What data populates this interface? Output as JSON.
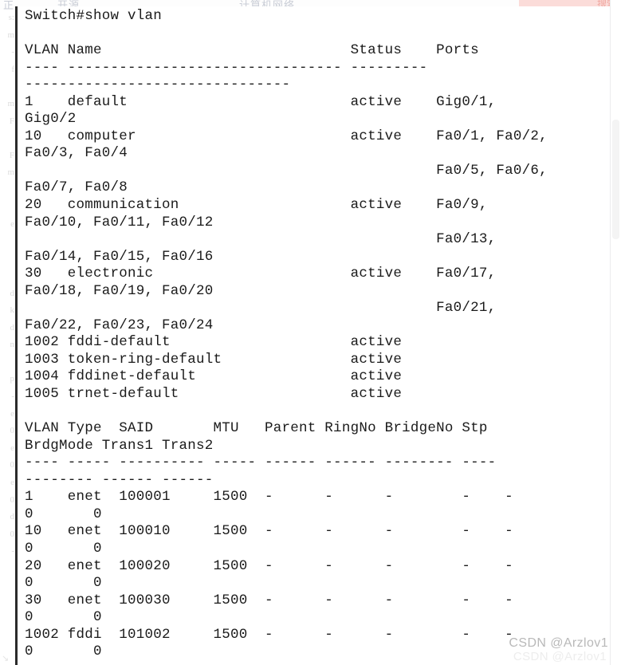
{
  "window": {
    "background_color": "#ffffff",
    "text_color": "#1a1a1a",
    "border_color": "#2b2b2b"
  },
  "top_strip": {
    "ghost_left": "正",
    "ghost_middle": "开源",
    "ghost_right": "计算机网络",
    "badge_label": "搜索",
    "badge_color": "#fbdcd9"
  },
  "ghost_margin": {
    "lines": "s:\nm\n-\nf\n\nm\nF\n\nF\nm\n\n\ne\n\n\n\nd\nk\nd\nn\n\np\n-\ne\n0\ne\n0\ne\n0\nd\n0\n-\n\n"
  },
  "terminal": {
    "prompt_line": "Switch#show vlan",
    "content": "Switch#show vlan\n\nVLAN Name                             Status    Ports\n---- -------------------------------- ---------\n-------------------------------\n1    default                          active    Gig0/1,\nGig0/2\n10   computer                         active    Fa0/1, Fa0/2,\nFa0/3, Fa0/4\n                                                Fa0/5, Fa0/6,\nFa0/7, Fa0/8\n20   communication                    active    Fa0/9,\nFa0/10, Fa0/11, Fa0/12\n                                                Fa0/13,\nFa0/14, Fa0/15, Fa0/16\n30   electronic                       active    Fa0/17,\nFa0/18, Fa0/19, Fa0/20\n                                                Fa0/21,\nFa0/22, Fa0/23, Fa0/24\n1002 fddi-default                     active\n1003 token-ring-default               active\n1004 fddinet-default                  active\n1005 trnet-default                    active\n\nVLAN Type  SAID       MTU   Parent RingNo BridgeNo Stp\nBrdgMode Trans1 Trans2\n---- ----- ---------- ----- ------ ------ -------- ----\n-------- ------ ------\n1    enet  100001     1500  -      -      -        -    -\n0       0\n10   enet  100010     1500  -      -      -        -    -\n0       0\n20   enet  100020     1500  -      -      -        -    -\n0       0\n30   enet  100030     1500  -      -      -        -    -\n0       0\n1002 fddi  101002     1500  -      -      -        -    -\n0       0"
  },
  "vlan_table": {
    "headers": [
      "VLAN",
      "Name",
      "Status",
      "Ports"
    ],
    "rows": [
      {
        "vlan": "1",
        "name": "default",
        "status": "active",
        "ports": [
          "Gig0/1",
          "Gig0/2"
        ]
      },
      {
        "vlan": "10",
        "name": "computer",
        "status": "active",
        "ports": [
          "Fa0/1",
          "Fa0/2",
          "Fa0/3",
          "Fa0/4",
          "Fa0/5",
          "Fa0/6",
          "Fa0/7",
          "Fa0/8"
        ]
      },
      {
        "vlan": "20",
        "name": "communication",
        "status": "active",
        "ports": [
          "Fa0/9",
          "Fa0/10",
          "Fa0/11",
          "Fa0/12",
          "Fa0/13",
          "Fa0/14",
          "Fa0/15",
          "Fa0/16"
        ]
      },
      {
        "vlan": "30",
        "name": "electronic",
        "status": "active",
        "ports": [
          "Fa0/17",
          "Fa0/18",
          "Fa0/19",
          "Fa0/20",
          "Fa0/21",
          "Fa0/22",
          "Fa0/23",
          "Fa0/24"
        ]
      },
      {
        "vlan": "1002",
        "name": "fddi-default",
        "status": "active",
        "ports": []
      },
      {
        "vlan": "1003",
        "name": "token-ring-default",
        "status": "active",
        "ports": []
      },
      {
        "vlan": "1004",
        "name": "fddinet-default",
        "status": "active",
        "ports": []
      },
      {
        "vlan": "1005",
        "name": "trnet-default",
        "status": "active",
        "ports": []
      }
    ]
  },
  "vlan_detail_table": {
    "headers": [
      "VLAN",
      "Type",
      "SAID",
      "MTU",
      "Parent",
      "RingNo",
      "BridgeNo",
      "Stp",
      "BrdgMode",
      "Trans1",
      "Trans2"
    ],
    "rows": [
      {
        "vlan": "1",
        "type": "enet",
        "said": "100001",
        "mtu": "1500",
        "parent": "-",
        "ringno": "-",
        "bridgeno": "-",
        "stp": "-",
        "brdgmode": "-",
        "trans1": "0",
        "trans2": "0"
      },
      {
        "vlan": "10",
        "type": "enet",
        "said": "100010",
        "mtu": "1500",
        "parent": "-",
        "ringno": "-",
        "bridgeno": "-",
        "stp": "-",
        "brdgmode": "-",
        "trans1": "0",
        "trans2": "0"
      },
      {
        "vlan": "20",
        "type": "enet",
        "said": "100020",
        "mtu": "1500",
        "parent": "-",
        "ringno": "-",
        "bridgeno": "-",
        "stp": "-",
        "brdgmode": "-",
        "trans1": "0",
        "trans2": "0"
      },
      {
        "vlan": "30",
        "type": "enet",
        "said": "100030",
        "mtu": "1500",
        "parent": "-",
        "ringno": "-",
        "bridgeno": "-",
        "stp": "-",
        "brdgmode": "-",
        "trans1": "0",
        "trans2": "0"
      },
      {
        "vlan": "1002",
        "type": "fddi",
        "said": "101002",
        "mtu": "1500",
        "parent": "-",
        "ringno": "-",
        "bridgeno": "-",
        "stp": "-",
        "brdgmode": "-",
        "trans1": "0",
        "trans2": "0"
      }
    ]
  },
  "watermark": {
    "text": "CSDN @Arzlov1",
    "ghost_text": "CSDN @Arzlov1",
    "corner_ghost": "↘"
  }
}
